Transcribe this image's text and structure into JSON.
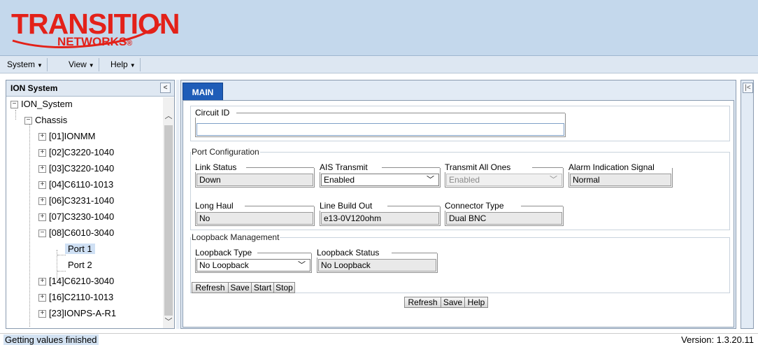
{
  "brand": {
    "name": "TRANSITION",
    "sub": "NETWORKS",
    "reg": "®",
    "color": "#e32119"
  },
  "menu": [
    {
      "label": "System"
    },
    {
      "label": "View"
    },
    {
      "label": "Help"
    }
  ],
  "left_panel": {
    "title": "ION System",
    "collapse_icon": "«",
    "tree": [
      {
        "label": "ION_System"
      },
      {
        "label": "Chassis"
      },
      {
        "label": "[01]IONMM"
      },
      {
        "label": "[02]C3220-1040"
      },
      {
        "label": "[03]C3220-1040"
      },
      {
        "label": "[04]C6110-1013"
      },
      {
        "label": "[06]C3231-1040"
      },
      {
        "label": "[07]C3230-1040"
      },
      {
        "label": "[08]C6010-3040"
      },
      {
        "label": "Port 1"
      },
      {
        "label": "Port 2"
      },
      {
        "label": "[14]C6210-3040"
      },
      {
        "label": "[16]C2110-1013"
      },
      {
        "label": "[23]IONPS-A-R1"
      }
    ]
  },
  "main": {
    "tab": "MAIN",
    "circuit": {
      "legend": "Circuit ID",
      "value": ""
    },
    "port_config": {
      "legend": "Port Configuration",
      "link_status": {
        "label": "Link Status",
        "value": "Down"
      },
      "ais_transmit": {
        "label": "AIS Transmit",
        "value": "Enabled"
      },
      "transmit_all_ones": {
        "label": "Transmit All Ones",
        "value": "Enabled"
      },
      "alarm_indication": {
        "label": "Alarm Indication Signal",
        "value": "Normal"
      },
      "long_haul": {
        "label": "Long Haul",
        "value": "No"
      },
      "line_build_out": {
        "label": "Line Build Out",
        "value": "e13-0V120ohm"
      },
      "connector_type": {
        "label": "Connector Type",
        "value": "Dual BNC"
      }
    },
    "loopback": {
      "legend": "Loopback Management",
      "type": {
        "label": "Loopback Type",
        "value": "No Loopback"
      },
      "status": {
        "label": "Loopback Status",
        "value": "No Loopback"
      },
      "buttons": {
        "refresh": "Refresh",
        "save": "Save",
        "start": "Start",
        "stop": "Stop"
      }
    },
    "bottom_buttons": {
      "refresh": "Refresh",
      "save": "Save",
      "help": "Help"
    }
  },
  "status": {
    "text": "Getting values finished",
    "version": "Version: 1.3.20.11"
  }
}
